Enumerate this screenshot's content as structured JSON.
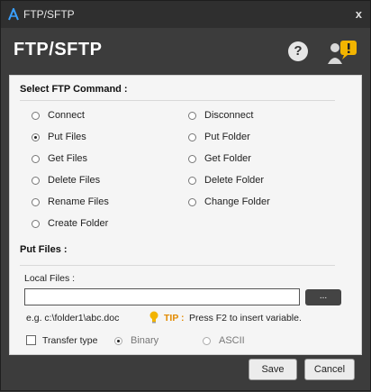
{
  "window": {
    "title": "FTP/SFTP",
    "close_glyph": "x"
  },
  "header": {
    "title": "FTP/SFTP",
    "help_glyph": "?"
  },
  "command_section": {
    "label": "Select FTP Command :",
    "left_options": [
      "Connect",
      "Put Files",
      "Get Files",
      "Delete Files",
      "Rename Files",
      "Create Folder"
    ],
    "right_options": [
      "Disconnect",
      "Put Folder",
      "Get Folder",
      "Delete Folder",
      "Change Folder"
    ],
    "selected": "Put Files"
  },
  "put_section": {
    "label": "Put Files :",
    "local_files_label": "Local Files :",
    "local_files_value": "",
    "browse_label": "...",
    "example": "e.g. c:\\folder1\\abc.doc",
    "tip_label": "TIP :",
    "tip_text": "Press F2 to insert variable.",
    "transfer_type_label": "Transfer type",
    "binary_label": "Binary",
    "ascii_label": "ASCII"
  },
  "footer": {
    "save_label": "Save",
    "cancel_label": "Cancel"
  }
}
